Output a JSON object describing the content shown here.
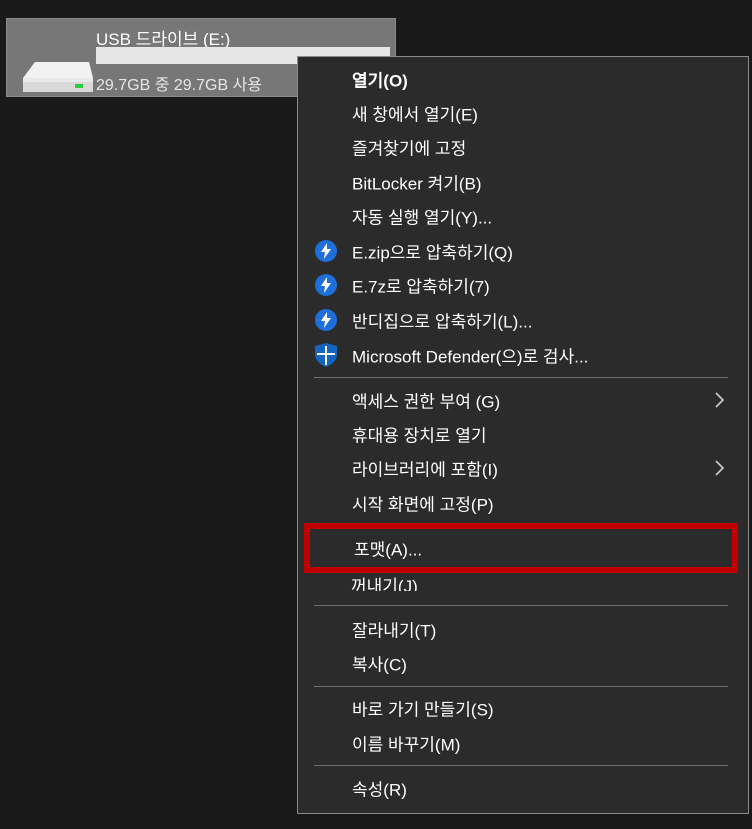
{
  "drive": {
    "name": "USB 드라이브 (E:)",
    "usage_text": "29.7GB 중 29.7GB 사용",
    "usage_fraction": 1.0,
    "icon": "usb-drive-icon"
  },
  "menu": {
    "items": [
      {
        "label": "열기(O)",
        "icon": null,
        "bold": true,
        "submenu": false
      },
      {
        "label": "새 창에서 열기(E)",
        "icon": null,
        "bold": false,
        "submenu": false
      },
      {
        "label": "즐겨찾기에 고정",
        "icon": null,
        "bold": false,
        "submenu": false
      },
      {
        "label": "BitLocker 켜기(B)",
        "icon": null,
        "bold": false,
        "submenu": false
      },
      {
        "label": "자동 실행 열기(Y)...",
        "icon": null,
        "bold": false,
        "submenu": false
      },
      {
        "label": "E.zip으로 압축하기(Q)",
        "icon": "bandizip-icon",
        "bold": false,
        "submenu": false
      },
      {
        "label": "E.7z로 압축하기(7)",
        "icon": "bandizip-icon",
        "bold": false,
        "submenu": false
      },
      {
        "label": "반디집으로 압축하기(L)...",
        "icon": "bandizip-icon",
        "bold": false,
        "submenu": false
      },
      {
        "label": "Microsoft Defender(으)로 검사...",
        "icon": "defender-shield-icon",
        "bold": false,
        "submenu": false
      },
      {
        "label": "액세스 권한 부여 (G)",
        "icon": null,
        "bold": false,
        "submenu": true
      },
      {
        "label": "휴대용 장치로 열기",
        "icon": null,
        "bold": false,
        "submenu": false
      },
      {
        "label": "라이브러리에 포함(I)",
        "icon": null,
        "bold": false,
        "submenu": true
      },
      {
        "label": "시작 화면에 고정(P)",
        "icon": null,
        "bold": false,
        "submenu": false
      },
      {
        "label": "포맷(A)...",
        "icon": null,
        "bold": false,
        "submenu": false,
        "highlighted": true
      },
      {
        "label": "꺼내기(J)",
        "icon": null,
        "bold": false,
        "submenu": false
      },
      {
        "label": "잘라내기(T)",
        "icon": null,
        "bold": false,
        "submenu": false
      },
      {
        "label": "복사(C)",
        "icon": null,
        "bold": false,
        "submenu": false
      },
      {
        "label": "바로 가기 만들기(S)",
        "icon": null,
        "bold": false,
        "submenu": false
      },
      {
        "label": "이름 바꾸기(M)",
        "icon": null,
        "bold": false,
        "submenu": false
      },
      {
        "label": "속성(R)",
        "icon": null,
        "bold": false,
        "submenu": false
      }
    ]
  },
  "colors": {
    "menu_bg": "#2b2b2b",
    "highlight_border": "#c00000",
    "bandizip_blue": "#1e6fd9",
    "defender_blue": "#1565c0"
  }
}
